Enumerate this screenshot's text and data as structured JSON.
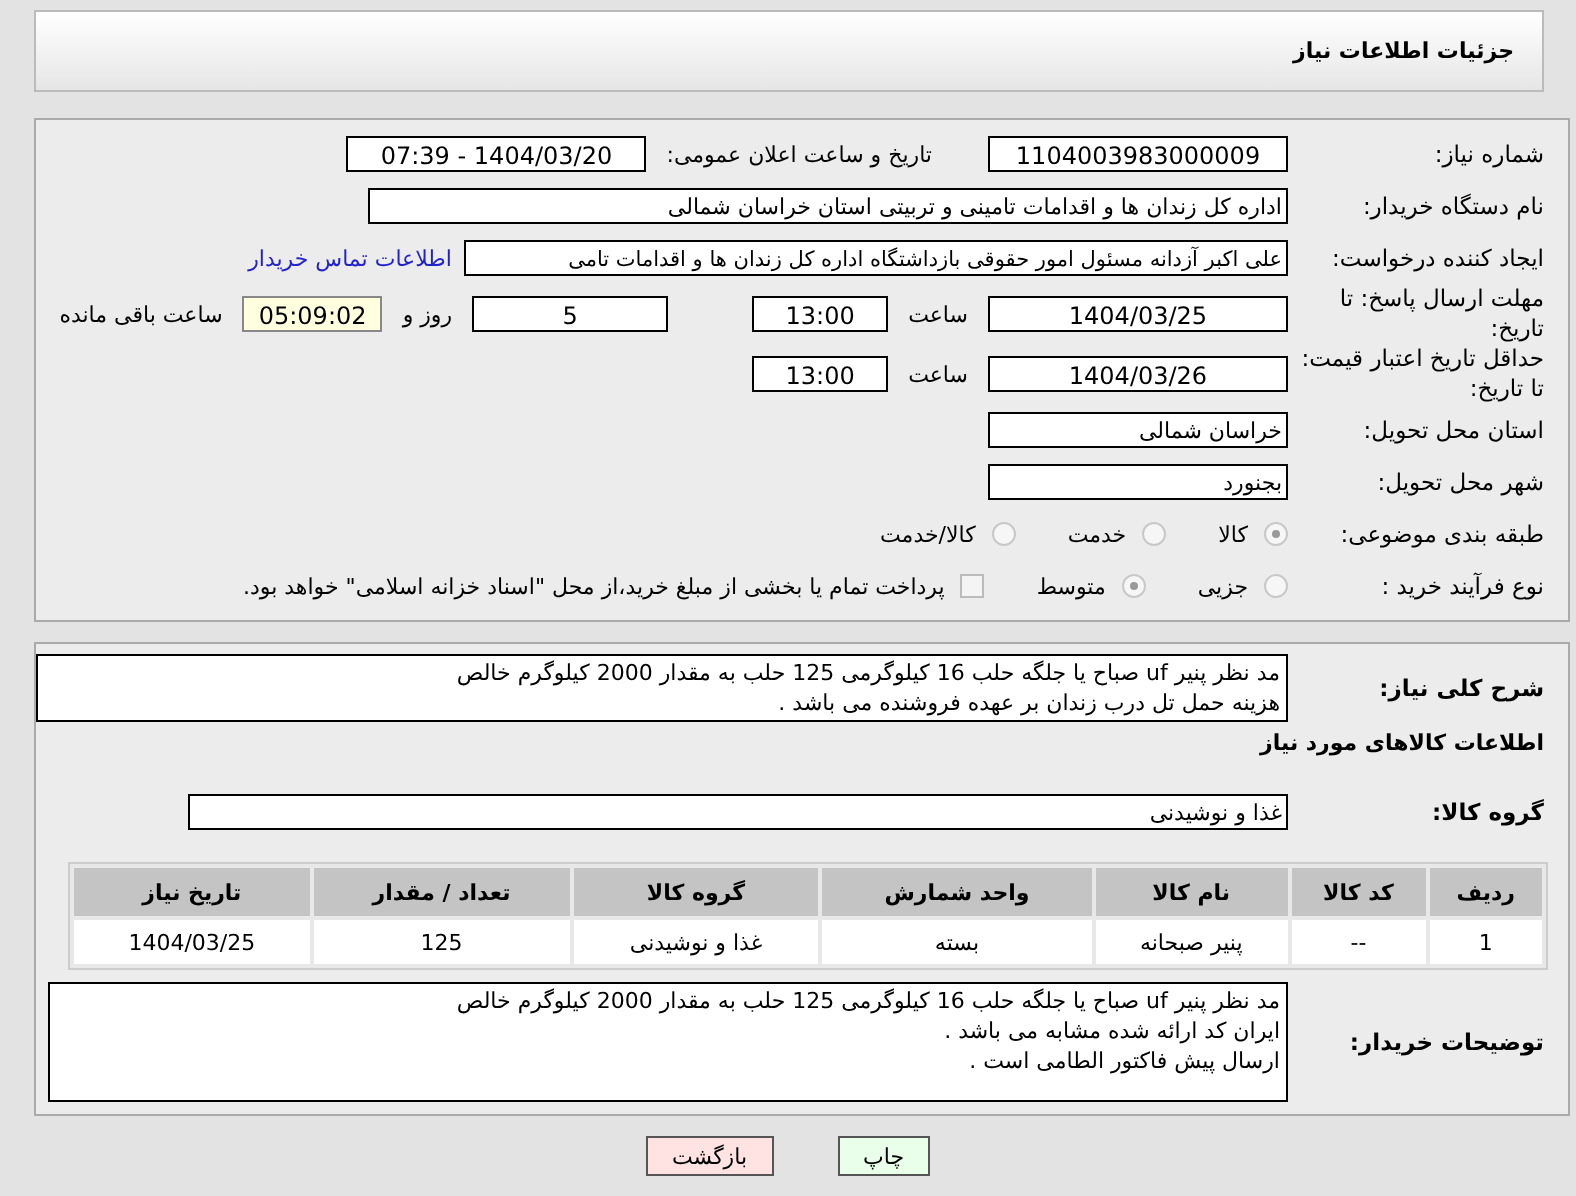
{
  "header": {
    "title": "جزئیات اطلاعات نیاز"
  },
  "details": {
    "need_number": {
      "label": "شماره نیاز:",
      "value": "1104003983000009"
    },
    "announce": {
      "label": "تاریخ و ساعت اعلان عمومی:",
      "value": "1404/03/20 - 07:39"
    },
    "buyer_org": {
      "label": "نام دستگاه خریدار:",
      "value": "اداره کل زندان ها و اقدامات تامینی و تربیتی استان خراسان شمالی"
    },
    "requester": {
      "label": "ایجاد کننده درخواست:",
      "value": "علی اکبر  آزدانه مسئول امور حقوقی بازداشتگاه اداره کل زندان ها و اقدامات تامی",
      "link": "اطلاعات تماس خریدار"
    },
    "reply_deadline": {
      "label": "مهلت ارسال پاسخ: تا تاریخ:",
      "date": "1404/03/25",
      "time_label": "ساعت",
      "time": "13:00",
      "days": "5",
      "days_label": "روز و",
      "remaining": "05:09:02",
      "remaining_label": "ساعت باقی مانده"
    },
    "price_validity": {
      "label": "حداقل تاریخ اعتبار قیمت: تا تاریخ:",
      "date": "1404/03/26",
      "time_label": "ساعت",
      "time": "13:00"
    },
    "province": {
      "label": "استان محل تحویل:",
      "value": "خراسان شمالی"
    },
    "city": {
      "label": "شهر محل تحویل:",
      "value": "بجنورد"
    },
    "category": {
      "label": "طبقه بندی موضوعی:",
      "options": [
        {
          "label": "کالا",
          "selected": true
        },
        {
          "label": "خدمت",
          "selected": false
        },
        {
          "label": "کالا/خدمت",
          "selected": false
        }
      ]
    },
    "process": {
      "label": "نوع فرآیند خرید :",
      "options": [
        {
          "label": "جزیی",
          "selected": false
        },
        {
          "label": "متوسط",
          "selected": true
        }
      ],
      "payment": {
        "label": "پرداخت تمام یا بخشی از مبلغ خرید،از محل \"اسناد خزانه اسلامی\" خواهد بود.",
        "checked": false
      }
    }
  },
  "description": {
    "label": "شرح کلی نیاز:",
    "text": "مد نظر پنیر uf صباح یا جلگه حلب 16 کیلوگرمی 125 حلب به مقدار 2000 کیلوگرم خالص\nهزینه حمل تل درب زندان بر عهده فروشنده می باشد ."
  },
  "goods": {
    "title": "اطلاعات کالاهای مورد نیاز",
    "group": {
      "label": "گروه کالا:",
      "value": "غذا و نوشیدنی"
    },
    "table": {
      "columns": [
        "ردیف",
        "کد کالا",
        "نام کالا",
        "واحد شمارش",
        "گروه کالا",
        "تعداد / مقدار",
        "تاریخ نیاز"
      ],
      "rows": [
        [
          "1",
          "--",
          "پنیر صبحانه",
          "بسته",
          "غذا و نوشیدنی",
          "125",
          "1404/03/25"
        ]
      ]
    }
  },
  "buyer_notes": {
    "label": "توضیحات خریدار:",
    "text": "مد نظر پنیر uf صباح یا جلگه حلب 16 کیلوگرمی 125 حلب به مقدار 2000 کیلوگرم خالص\nایران کد ارائه شده مشابه می باشد .\nارسال پیش فاکتور الطامی است ."
  },
  "buttons": [
    {
      "label": "چاپ",
      "kind": "print"
    },
    {
      "label": "بازگشت",
      "kind": "back"
    }
  ]
}
